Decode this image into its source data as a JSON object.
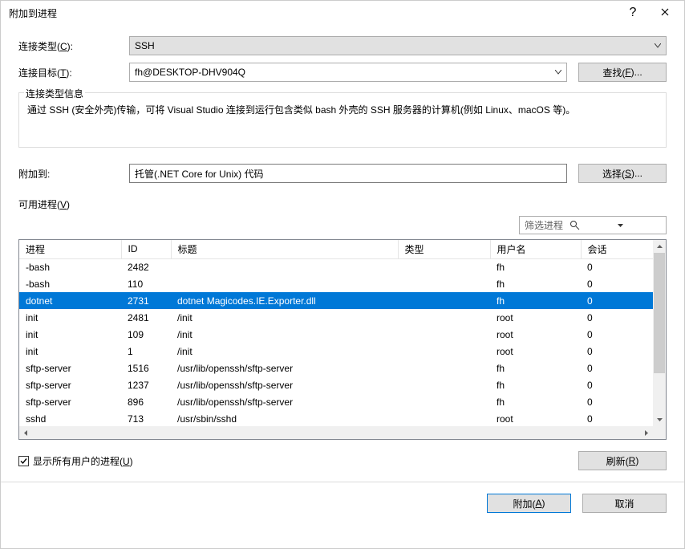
{
  "titlebar": {
    "title": "附加到进程"
  },
  "form": {
    "conn_type_label": "连接类型(C):",
    "conn_type_value": "SSH",
    "conn_target_label": "连接目标(T):",
    "conn_target_value": "fh@DESKTOP-DHV904Q",
    "find_label": "查找(F)..."
  },
  "info": {
    "legend": "连接类型信息",
    "text": "通过 SSH (安全外壳)传输，可将 Visual Studio 连接到运行包含类似 bash 外壳的 SSH 服务器的计算机(例如 Linux、macOS 等)。"
  },
  "attach": {
    "label": "附加到:",
    "value": "托管(.NET Core for Unix) 代码",
    "select_label": "选择(S)..."
  },
  "avail_label": "可用进程(V)",
  "filter_placeholder": "筛选进程",
  "headers": {
    "proc": "进程",
    "id": "ID",
    "title": "标题",
    "type": "类型",
    "user": "用户名",
    "sess": "会话"
  },
  "rows": [
    {
      "proc": "-bash",
      "id": "2482",
      "title": "",
      "type": "",
      "user": "fh",
      "sess": "0",
      "sel": false
    },
    {
      "proc": "-bash",
      "id": "110",
      "title": "",
      "type": "",
      "user": "fh",
      "sess": "0",
      "sel": false
    },
    {
      "proc": "dotnet",
      "id": "2731",
      "title": "dotnet Magicodes.IE.Exporter.dll",
      "type": "",
      "user": "fh",
      "sess": "0",
      "sel": true
    },
    {
      "proc": "init",
      "id": "2481",
      "title": "/init",
      "type": "",
      "user": "root",
      "sess": "0",
      "sel": false
    },
    {
      "proc": "init",
      "id": "109",
      "title": "/init",
      "type": "",
      "user": "root",
      "sess": "0",
      "sel": false
    },
    {
      "proc": "init",
      "id": "1",
      "title": "/init",
      "type": "",
      "user": "root",
      "sess": "0",
      "sel": false
    },
    {
      "proc": "sftp-server",
      "id": "1516",
      "title": "/usr/lib/openssh/sftp-server",
      "type": "",
      "user": "fh",
      "sess": "0",
      "sel": false
    },
    {
      "proc": "sftp-server",
      "id": "1237",
      "title": "/usr/lib/openssh/sftp-server",
      "type": "",
      "user": "fh",
      "sess": "0",
      "sel": false
    },
    {
      "proc": "sftp-server",
      "id": "896",
      "title": "/usr/lib/openssh/sftp-server",
      "type": "",
      "user": "fh",
      "sess": "0",
      "sel": false
    },
    {
      "proc": "sshd",
      "id": "713",
      "title": "/usr/sbin/sshd",
      "type": "",
      "user": "root",
      "sess": "0",
      "sel": false
    }
  ],
  "show_all_label": "显示所有用户的进程(U)",
  "refresh_label": "刷新(R)",
  "footer": {
    "attach": "附加(A)",
    "cancel": "取消"
  }
}
